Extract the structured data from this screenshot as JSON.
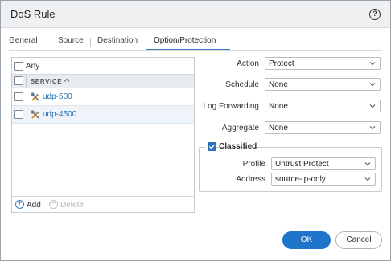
{
  "dialog": {
    "title": "DoS Rule",
    "help_icon": "question-icon"
  },
  "tabs": [
    {
      "label": "General"
    },
    {
      "label": "Source"
    },
    {
      "label": "Destination"
    },
    {
      "label": "Option/Protection",
      "active": true
    }
  ],
  "services": {
    "any_label": "Any",
    "any_checked": false,
    "column_header": "SERVICE",
    "sort_indicator": "^",
    "rows": [
      {
        "name": "udp-500",
        "icon": "service-icon",
        "checked": false
      },
      {
        "name": "udp-4500",
        "icon": "service-icon",
        "checked": false
      }
    ],
    "add_label": "Add",
    "delete_label": "Delete"
  },
  "form": {
    "action": {
      "label": "Action",
      "value": "Protect"
    },
    "schedule": {
      "label": "Schedule",
      "value": "None"
    },
    "log_forwarding": {
      "label": "Log Forwarding",
      "value": "None"
    },
    "aggregate": {
      "label": "Aggregate",
      "value": "None"
    },
    "classified": {
      "label": "Classified",
      "checked": true,
      "profile": {
        "label": "Profile",
        "value": "Untrust Protect"
      },
      "address": {
        "label": "Address",
        "value": "source-ip-only"
      }
    }
  },
  "buttons": {
    "ok": "OK",
    "cancel": "Cancel"
  },
  "colors": {
    "accent": "#1e74c9",
    "link": "#1f6fb5",
    "title_bar": "#eef0f2"
  }
}
